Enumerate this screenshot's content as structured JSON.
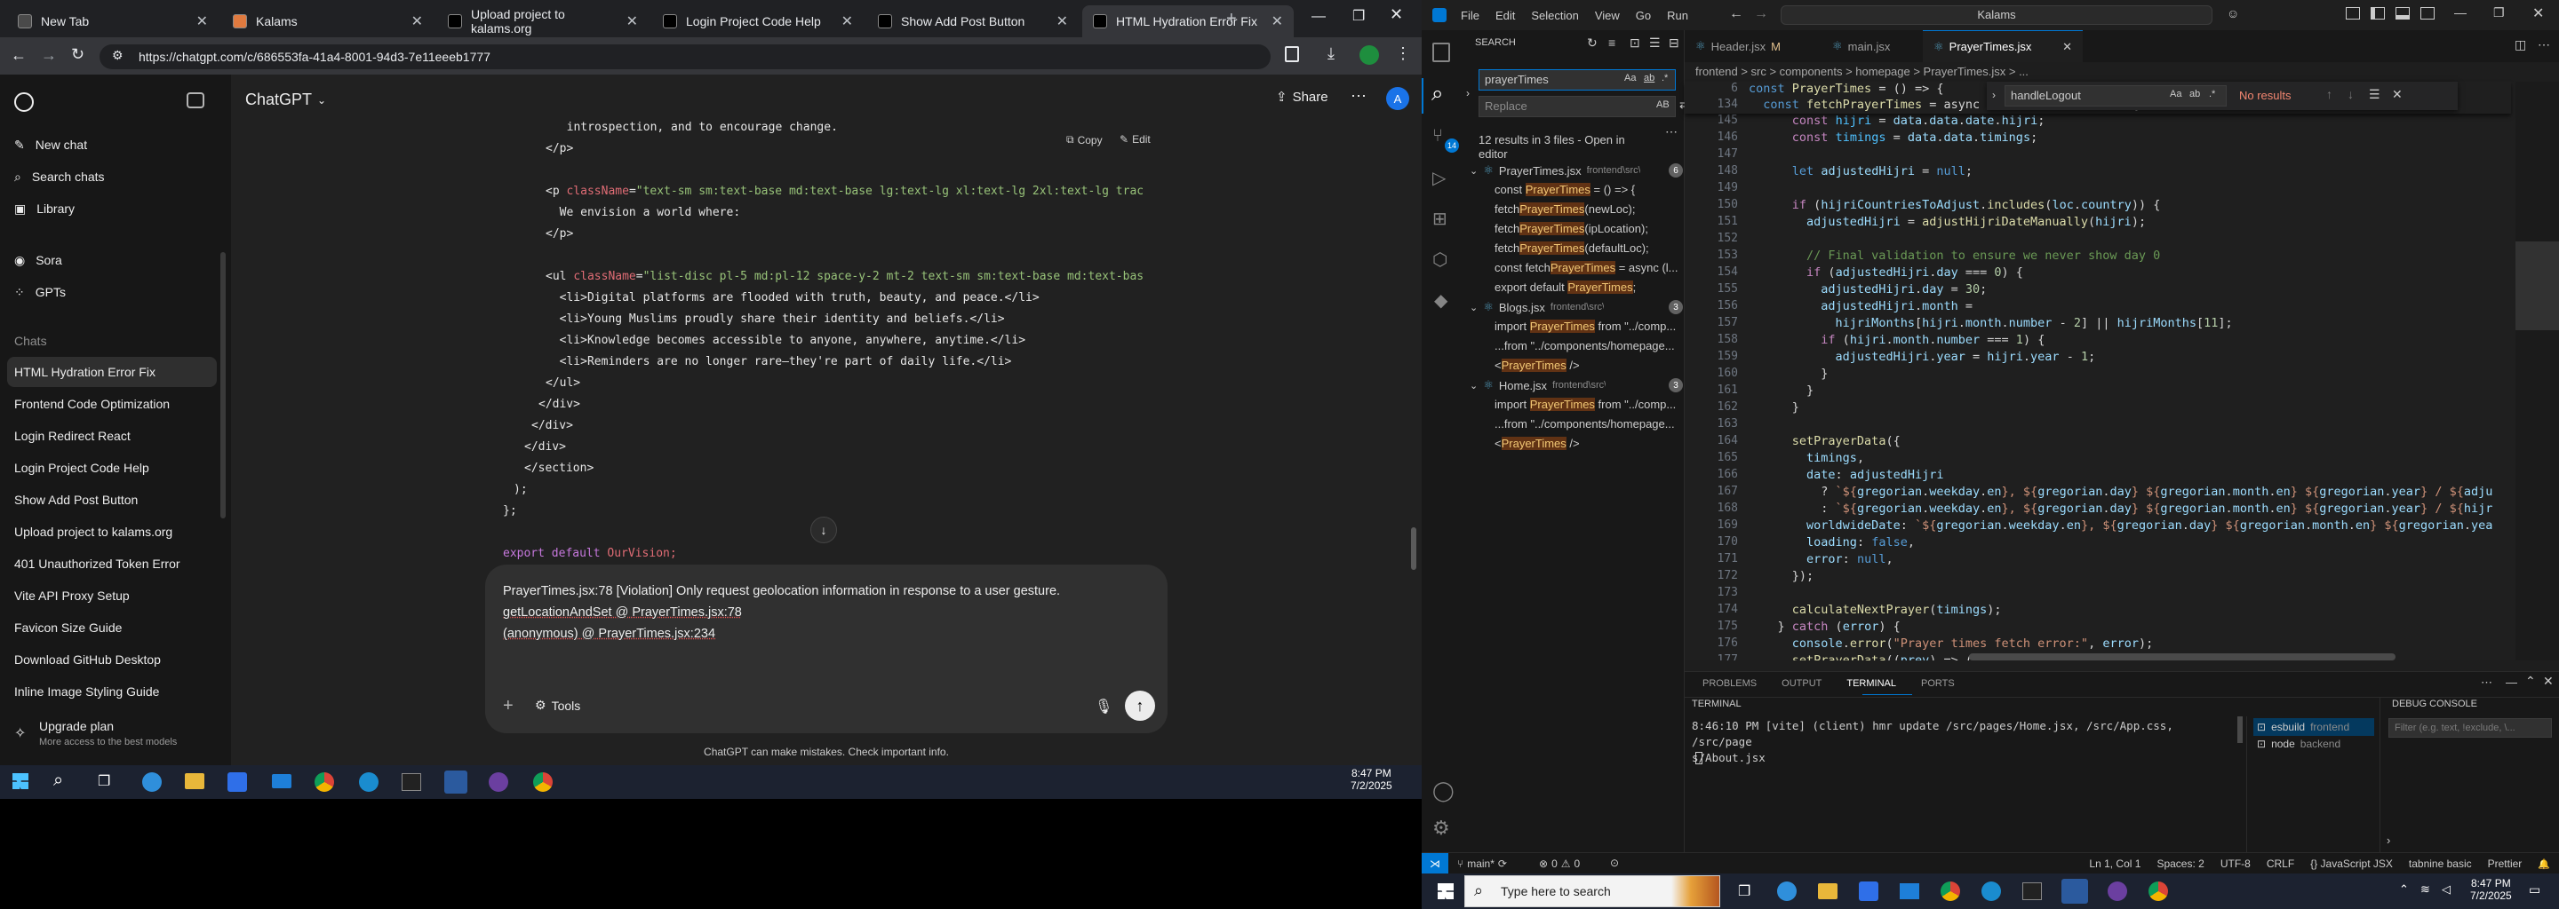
{
  "browser": {
    "tabs": [
      {
        "label": "New Tab",
        "color": "#4a4a4a"
      },
      {
        "label": "Kalams",
        "color": "#e07a3f"
      },
      {
        "label": "Upload project to kalams.org",
        "color": "#000"
      },
      {
        "label": "Login Project Code Help",
        "color": "#000"
      },
      {
        "label": "Show Add Post Button",
        "color": "#000"
      },
      {
        "label": "HTML Hydration Error Fix",
        "color": "#000"
      }
    ],
    "url": "https://chatgpt.com/c/686553fa-41a4-8001-94d3-7e11eeeb1777"
  },
  "chatgpt": {
    "brand": "ChatGPT",
    "share": "Share",
    "copy": "Copy",
    "edit": "Edit",
    "nav": [
      "New chat",
      "Search chats",
      "Library",
      "Sora",
      "GPTs"
    ],
    "chats_heading": "Chats",
    "chats": [
      "HTML Hydration Error Fix",
      "Frontend Code Optimization",
      "Login Redirect React",
      "Login Project Code Help",
      "Show Add Post Button",
      "Upload project to kalams.org",
      "401 Unauthorized Token Error",
      "Vite API Proxy Setup",
      "Favicon Size Guide",
      "Download GitHub Desktop",
      "Inline Image Styling Guide"
    ],
    "upgrade_title": "Upgrade plan",
    "upgrade_sub": "More access to the best models",
    "code_lines": [
      "  introspection, and to encourage change.",
      "</p>",
      "",
      "<p className=\"text-sm sm:text-base md:text-base lg:text-lg xl:text-lg 2xl:text-lg trac",
      "  We envision a world where:",
      "</p>",
      "",
      "<ul className=\"list-disc pl-5 md:pl-12 space-y-2 mt-2 text-sm sm:text-base md:text-bas",
      "  <li>Digital platforms are flooded with truth, beauty, and peace.</li>",
      "  <li>Young Muslims proudly share their identity and beliefs.</li>",
      "  <li>Knowledge becomes accessible to anyone, anywhere, anytime.</li>",
      "  <li>Reminders are no longer rare—they're part of daily life.</li>",
      "</ul>",
      "</div>",
      "</div>",
      "</div>",
      "</section>",
      ");",
      "};",
      "",
      "export default OurVision;"
    ],
    "composer_lines": [
      "PrayerTimes.jsx:78 [Violation] Only request geolocation information in response to a user gesture.",
      "getLocationAndSet @ PrayerTimes.jsx:78",
      "(anonymous)    @ PrayerTimes.jsx:234"
    ],
    "tools": "Tools",
    "disclaimer": "ChatGPT can make mistakes. Check important info.",
    "clock_time": "8:47 PM",
    "clock_date": "7/2/2025"
  },
  "vscode": {
    "menu": [
      "File",
      "Edit",
      "Selection",
      "View",
      "Go",
      "Run"
    ],
    "search_box": "Kalams",
    "search_title": "SEARCH",
    "search_query": "prayerTimes",
    "replace_placeholder": "Replace",
    "results_summary": "12 results in 3 files - Open in editor",
    "results": [
      {
        "type": "file",
        "name": "PrayerTimes.jsx",
        "path": "frontend\\src\\pag...",
        "count": "6"
      },
      {
        "type": "match",
        "pre": "const ",
        "hit": "PrayerTimes",
        "post": " = () => {"
      },
      {
        "type": "match",
        "pre": "fetch",
        "hit": "PrayerTimes",
        "post": "(newLoc);"
      },
      {
        "type": "match",
        "pre": "fetch",
        "hit": "PrayerTimes",
        "post": "(ipLocation);"
      },
      {
        "type": "match",
        "pre": "fetch",
        "hit": "PrayerTimes",
        "post": "(defaultLoc);"
      },
      {
        "type": "match",
        "pre": "const fetch",
        "hit": "PrayerTimes",
        "post": " = async (l..."
      },
      {
        "type": "match",
        "pre": "export default ",
        "hit": "PrayerTimes",
        "post": ";"
      },
      {
        "type": "file",
        "name": "Blogs.jsx",
        "path": "frontend\\src\\pages",
        "count": "3"
      },
      {
        "type": "match",
        "pre": "import ",
        "hit": "PrayerTimes",
        "post": " from \"../comp..."
      },
      {
        "type": "match",
        "pre": "...from \"../components/homepage...",
        "hit": "",
        "post": ""
      },
      {
        "type": "match",
        "pre": "<",
        "hit": "PrayerTimes",
        "post": " />"
      },
      {
        "type": "file",
        "name": "Home.jsx",
        "path": "frontend\\src\\pages",
        "count": "3"
      },
      {
        "type": "match",
        "pre": "import ",
        "hit": "PrayerTimes",
        "post": " from \"../comp..."
      },
      {
        "type": "match",
        "pre": "...from \"../components/homepage...",
        "hit": "",
        "post": ""
      },
      {
        "type": "match",
        "pre": "<",
        "hit": "PrayerTimes",
        "post": " />"
      }
    ],
    "tabs": [
      {
        "label": "Header.jsx",
        "mark": "M"
      },
      {
        "label": "main.jsx",
        "mark": ""
      },
      {
        "label": "PrayerTimes.jsx",
        "mark": ""
      }
    ],
    "breadcrumb": "frontend > src > components > homepage > PrayerTimes.jsx > ...",
    "find_query": "handleLogout",
    "find_result": "No results",
    "sticky_lines": [
      {
        "n": "6",
        "t": "const PrayerTimes = () => {"
      },
      {
        "n": "134",
        "t": "  const fetchPrayerTimes = async (loc = location) => {"
      }
    ],
    "lines": [
      {
        "n": "145",
        "h": "      <span class=k>const</span> <span class=co>hijri</span> = <span class=v>data</span>.<span class=v>data</span>.<span class=v>date</span>.<span class=v>hijri</span>;"
      },
      {
        "n": "146",
        "h": "      <span class=k>const</span> <span class=co>timings</span> = <span class=v>data</span>.<span class=v>data</span>.<span class=v>timings</span>;"
      },
      {
        "n": "147",
        "h": ""
      },
      {
        "n": "148",
        "h": "      <span class=t>let</span> <span class=v>adjustedHijri</span> = <span class=t>null</span>;"
      },
      {
        "n": "149",
        "h": ""
      },
      {
        "n": "150",
        "h": "      <span class=k>if</span> (<span class=v>hijriCountriesToAdjust</span>.<span class=f>includes</span>(<span class=v>loc</span>.<span class=v>country</span>)) {"
      },
      {
        "n": "151",
        "h": "        <span class=v>adjustedHijri</span> = <span class=f>adjustHijriDateManually</span>(<span class=v>hijri</span>);"
      },
      {
        "n": "152",
        "h": ""
      },
      {
        "n": "153",
        "h": "        <span class=c>// Final validation to ensure we never show day 0</span>"
      },
      {
        "n": "154",
        "h": "        <span class=k>if</span> (<span class=v>adjustedHijri</span>.<span class=v>day</span> === <span class=n>0</span>) {"
      },
      {
        "n": "155",
        "h": "          <span class=v>adjustedHijri</span>.<span class=v>day</span> = <span class=n>30</span>;"
      },
      {
        "n": "156",
        "h": "          <span class=v>adjustedHijri</span>.<span class=v>month</span> ="
      },
      {
        "n": "157",
        "h": "            <span class=v>hijriMonths</span>[<span class=v>hijri</span>.<span class=v>month</span>.<span class=v>number</span> - <span class=n>2</span>] || <span class=v>hijriMonths</span>[<span class=n>11</span>];"
      },
      {
        "n": "158",
        "h": "          <span class=k>if</span> (<span class=v>hijri</span>.<span class=v>month</span>.<span class=v>number</span> === <span class=n>1</span>) {"
      },
      {
        "n": "159",
        "h": "            <span class=v>adjustedHijri</span>.<span class=v>year</span> = <span class=v>hijri</span>.<span class=v>year</span> - <span class=n>1</span>;"
      },
      {
        "n": "160",
        "h": "          }"
      },
      {
        "n": "161",
        "h": "        }"
      },
      {
        "n": "162",
        "h": "      }"
      },
      {
        "n": "163",
        "h": ""
      },
      {
        "n": "164",
        "h": "      <span class=f>setPrayerData</span>({"
      },
      {
        "n": "165",
        "h": "        <span class=v>timings</span>,"
      },
      {
        "n": "166",
        "h": "        <span class=v>date</span>: <span class=v>adjustedHijri</span>"
      },
      {
        "n": "167",
        "h": "          ? <span class=s>`${</span><span class=v>gregorian</span>.<span class=v>weekday</span>.<span class=v>en</span><span class=s>}, ${</span><span class=v>gregorian</span>.<span class=v>day</span><span class=s>} ${</span><span class=v>gregorian</span>.<span class=v>month</span>.<span class=v>en</span><span class=s>} ${</span><span class=v>gregorian</span>.<span class=v>year</span><span class=s>} / ${</span><span class=v>adju</span>"
      },
      {
        "n": "168",
        "h": "          : <span class=s>`${</span><span class=v>gregorian</span>.<span class=v>weekday</span>.<span class=v>en</span><span class=s>}, ${</span><span class=v>gregorian</span>.<span class=v>day</span><span class=s>} ${</span><span class=v>gregorian</span>.<span class=v>month</span>.<span class=v>en</span><span class=s>} ${</span><span class=v>gregorian</span>.<span class=v>year</span><span class=s>} / ${</span><span class=v>hijr</span>"
      },
      {
        "n": "169",
        "h": "        <span class=v>worldwideDate</span>: <span class=s>`${</span><span class=v>gregorian</span>.<span class=v>weekday</span>.<span class=v>en</span><span class=s>}, ${</span><span class=v>gregorian</span>.<span class=v>day</span><span class=s>} ${</span><span class=v>gregorian</span>.<span class=v>month</span>.<span class=v>en</span><span class=s>} ${</span><span class=v>gregorian</span>.<span class=v>yea</span>"
      },
      {
        "n": "170",
        "h": "        <span class=v>loading</span>: <span class=t>false</span>,"
      },
      {
        "n": "171",
        "h": "        <span class=v>error</span>: <span class=t>null</span>,"
      },
      {
        "n": "172",
        "h": "      });"
      },
      {
        "n": "173",
        "h": ""
      },
      {
        "n": "174",
        "h": "      <span class=f>calculateNextPrayer</span>(<span class=v>timings</span>);"
      },
      {
        "n": "175",
        "h": "    } <span class=k>catch</span> (<span class=v>error</span>) {"
      },
      {
        "n": "176",
        "h": "      <span class=v>console</span>.<span class=f>error</span>(<span class=s>\"Prayer times fetch error:\"</span>, <span class=v>error</span>);"
      },
      {
        "n": "177",
        "h": "      <span class=f>setPrayerData</span>((<span class=v>prev</span>) => ({"
      }
    ],
    "panel_tabs": [
      "PROBLEMS",
      "OUTPUT",
      "TERMINAL",
      "PORTS"
    ],
    "terminal_title": "TERMINAL",
    "terminal_lines": [
      "8:46:10 PM [vite] (client) hmr update /src/pages/Home.jsx, /src/App.css, /src/page",
      "s/About.jsx"
    ],
    "terminals": [
      {
        "name": "esbuild",
        "sub": "frontend"
      },
      {
        "name": "node",
        "sub": "backend"
      }
    ],
    "debug_title": "DEBUG CONSOLE",
    "debug_filter": "Filter (e.g. text, !exclude, \\...",
    "status_left": [
      "main*",
      "0",
      "0"
    ],
    "status_right": [
      "Ln 1, Col 1",
      "Spaces: 2",
      "UTF-8",
      "CRLF",
      "{} JavaScript JSX",
      "tabnine basic",
      "Prettier"
    ],
    "clock_time": "8:47 PM",
    "clock_date": "7/2/2025",
    "search_placeholder": "Type here to search"
  }
}
